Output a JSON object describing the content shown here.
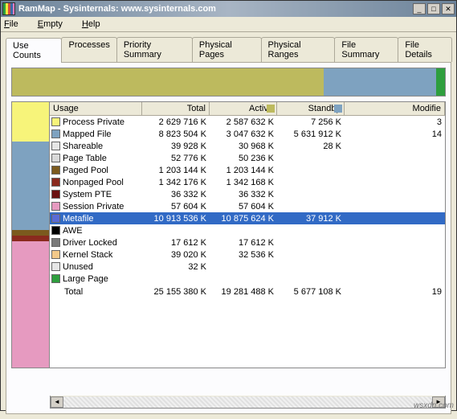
{
  "window": {
    "title": "RamMap - Sysinternals: www.sysinternals.com"
  },
  "menu": {
    "file": "File",
    "empty": "Empty",
    "help": "Help"
  },
  "tabs": {
    "use_counts": "Use Counts",
    "processes": "Processes",
    "priority_summary": "Priority Summary",
    "physical_pages": "Physical Pages",
    "physical_ranges": "Physical Ranges",
    "file_summary": "File Summary",
    "file_details": "File Details"
  },
  "columns": {
    "usage": "Usage",
    "total": "Total",
    "active": "Active",
    "standby": "Standby",
    "modified": "Modifie"
  },
  "colors": {
    "process_private": "#f7f47a",
    "mapped_file": "#7ea2c0",
    "shareable": "#e6e6e6",
    "page_table": "#d9d9d9",
    "paged_pool": "#7b5a1e",
    "nonpaged_pool": "#8a2a1e",
    "system_pte": "#6b1212",
    "session_private": "#e69ac0",
    "metafile": "#5a6bd6",
    "awe": "#000000",
    "driver_locked": "#7a7a7a",
    "kernel_stack": "#f3c98a",
    "unused": "#e6e6e6",
    "large_page": "#2e9e3e"
  },
  "rows": [
    {
      "key": "process_private",
      "usage": "Process Private",
      "total": "2 629 716 K",
      "active": "2 587 632 K",
      "standby": "7 256 K",
      "modified": "3"
    },
    {
      "key": "mapped_file",
      "usage": "Mapped File",
      "total": "8 823 504 K",
      "active": "3 047 632 K",
      "standby": "5 631 912 K",
      "modified": "14"
    },
    {
      "key": "shareable",
      "usage": "Shareable",
      "total": "39 928 K",
      "active": "30 968 K",
      "standby": "28 K",
      "modified": ""
    },
    {
      "key": "page_table",
      "usage": "Page Table",
      "total": "52 776 K",
      "active": "50 236 K",
      "standby": "",
      "modified": ""
    },
    {
      "key": "paged_pool",
      "usage": "Paged Pool",
      "total": "1 203 144 K",
      "active": "1 203 144 K",
      "standby": "",
      "modified": ""
    },
    {
      "key": "nonpaged_pool",
      "usage": "Nonpaged Pool",
      "total": "1 342 176 K",
      "active": "1 342 168 K",
      "standby": "",
      "modified": ""
    },
    {
      "key": "system_pte",
      "usage": "System PTE",
      "total": "36 332 K",
      "active": "36 332 K",
      "standby": "",
      "modified": ""
    },
    {
      "key": "session_private",
      "usage": "Session Private",
      "total": "57 604 K",
      "active": "57 604 K",
      "standby": "",
      "modified": ""
    },
    {
      "key": "metafile",
      "usage": "Metafile",
      "total": "10 913 536 K",
      "active": "10 875 624 K",
      "standby": "37 912 K",
      "modified": "",
      "selected": true
    },
    {
      "key": "awe",
      "usage": "AWE",
      "total": "",
      "active": "",
      "standby": "",
      "modified": ""
    },
    {
      "key": "driver_locked",
      "usage": "Driver Locked",
      "total": "17 612 K",
      "active": "17 612 K",
      "standby": "",
      "modified": ""
    },
    {
      "key": "kernel_stack",
      "usage": "Kernel Stack",
      "total": "39 020 K",
      "active": "32 536 K",
      "standby": "",
      "modified": ""
    },
    {
      "key": "unused",
      "usage": "Unused",
      "total": "32 K",
      "active": "",
      "standby": "",
      "modified": ""
    },
    {
      "key": "large_page",
      "usage": "Large Page",
      "total": "",
      "active": "",
      "standby": "",
      "modified": ""
    }
  ],
  "total_row": {
    "label": "Total",
    "total": "25 155 380 K",
    "active": "19 281 488 K",
    "standby": "5 677 108 K",
    "modified": "19"
  },
  "watermark": "wsxdn.com",
  "chart_data": {
    "type": "table",
    "title": "RamMap Use Counts",
    "columns": [
      "Usage",
      "Total (K)",
      "Active (K)",
      "Standby (K)"
    ],
    "rows": [
      [
        "Process Private",
        2629716,
        2587632,
        7256
      ],
      [
        "Mapped File",
        8823504,
        3047632,
        5631912
      ],
      [
        "Shareable",
        39928,
        30968,
        28
      ],
      [
        "Page Table",
        52776,
        50236,
        null
      ],
      [
        "Paged Pool",
        1203144,
        1203144,
        null
      ],
      [
        "Nonpaged Pool",
        1342176,
        1342168,
        null
      ],
      [
        "System PTE",
        36332,
        36332,
        null
      ],
      [
        "Session Private",
        57604,
        57604,
        null
      ],
      [
        "Metafile",
        10913536,
        10875624,
        37912
      ],
      [
        "AWE",
        null,
        null,
        null
      ],
      [
        "Driver Locked",
        17612,
        17612,
        null
      ],
      [
        "Kernel Stack",
        39020,
        32536,
        null
      ],
      [
        "Unused",
        32,
        null,
        null
      ],
      [
        "Large Page",
        null,
        null,
        null
      ],
      [
        "Total",
        25155380,
        19281488,
        5677108
      ]
    ]
  }
}
